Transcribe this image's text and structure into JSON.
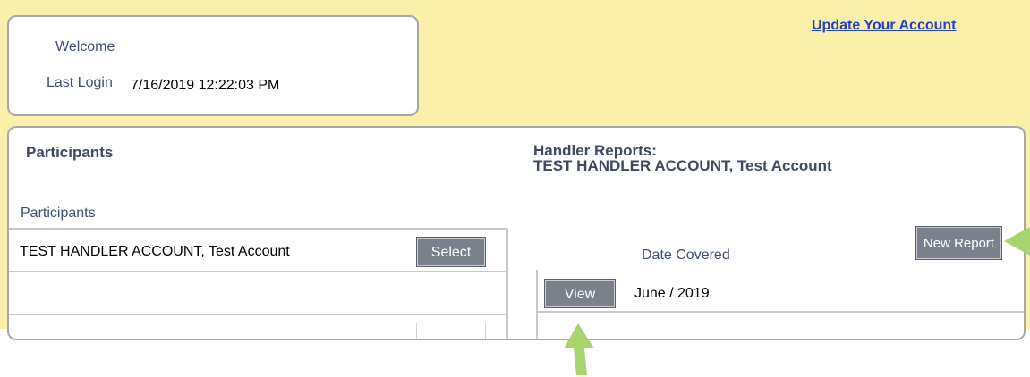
{
  "header": {
    "welcome_label": "Welcome",
    "last_login_label": "Last Login",
    "last_login_value": "7/16/2019 12:22:03 PM",
    "update_link": "Update Your Account"
  },
  "participants": {
    "heading": "Participants",
    "table_title": "Participants",
    "rows": [
      {
        "name": "TEST HANDLER ACCOUNT, Test Account",
        "select_label": "Select"
      },
      {
        "name": "",
        "select_label": ""
      }
    ]
  },
  "handler_reports": {
    "heading_line1": "Handler Reports:",
    "heading_line2": "TEST HANDLER ACCOUNT, Test Account",
    "new_report_label": "New Report",
    "column_date": "Date Covered",
    "rows": [
      {
        "view_label": "View",
        "date": "June / 2019"
      }
    ]
  },
  "colors": {
    "background_yellow": "#faf0aa",
    "button_gray": "#7b818b",
    "link_blue": "#1f3fcf",
    "arrow_green": "#a8d46f"
  }
}
